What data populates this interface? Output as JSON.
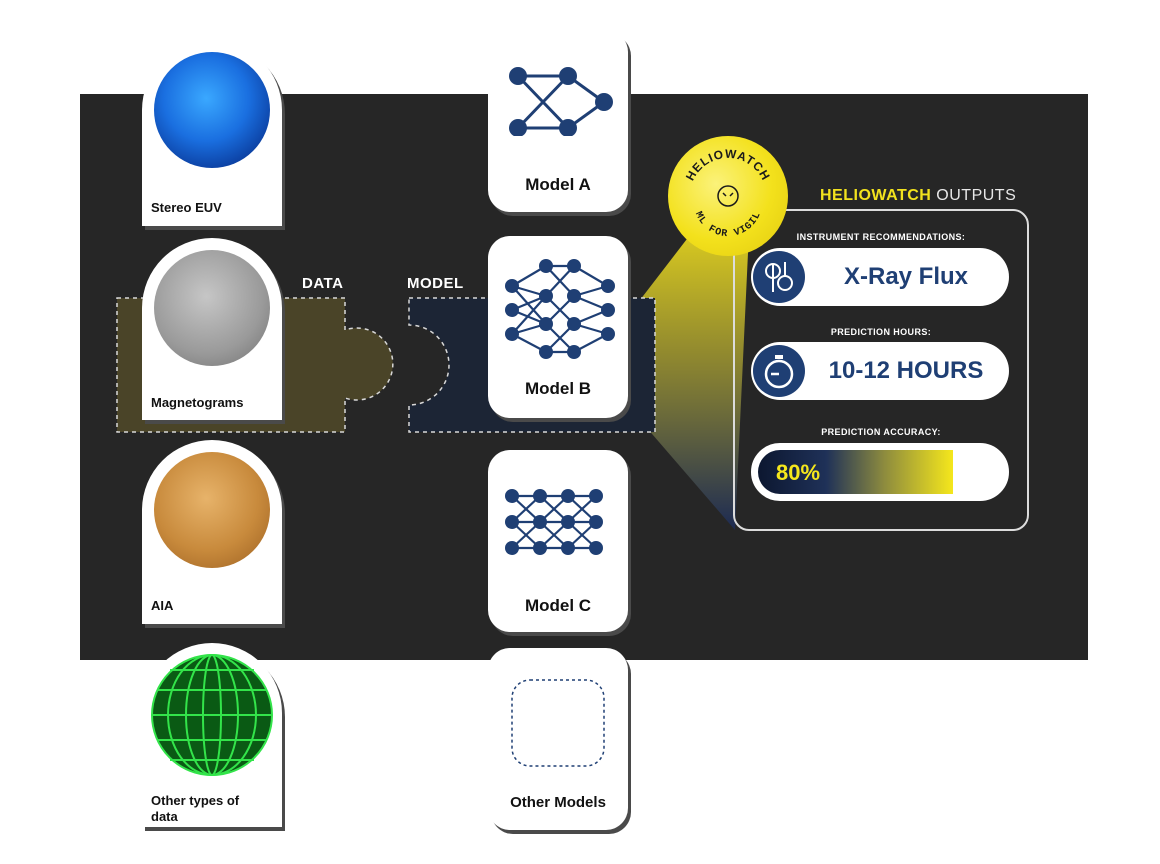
{
  "data_section": {
    "title": "DATA",
    "items": [
      {
        "label": "Stereo EUV"
      },
      {
        "label": "Magnetograms"
      },
      {
        "label": "AIA"
      },
      {
        "label": "Other types of data"
      }
    ]
  },
  "model_section": {
    "title": "MODEL",
    "items": [
      {
        "label": "Model A"
      },
      {
        "label": "Model B"
      },
      {
        "label": "Model C"
      },
      {
        "label": "Other Models"
      }
    ]
  },
  "badge": {
    "top_text": "HELIOWATCH",
    "bottom_text": "ML FOR VIGIL"
  },
  "outputs": {
    "title_highlight": "HELIOWATCH",
    "title_rest": " OUTPUTS",
    "instrument_label": "INSTRUMENT RECOMMENDATIONS:",
    "instrument_value": "X-Ray Flux",
    "hours_label": "PREDICTION HOURS:",
    "hours_value": "10-12 HOURS",
    "accuracy_label": "PREDICTION ACCURACY:",
    "accuracy_value": "80%",
    "accuracy_fraction": 0.8
  },
  "colors": {
    "panel": "#262626",
    "accent_yellow": "#f2e21e",
    "navy": "#1f3f74",
    "data_puzzle": "#4a4428",
    "model_puzzle": "#1c2535"
  },
  "icons": [
    "sun-euv-icon",
    "magnetogram-icon",
    "sun-aia-icon",
    "wireframe-globe-icon",
    "neural-net-icon",
    "instrument-icon",
    "stopwatch-icon"
  ]
}
